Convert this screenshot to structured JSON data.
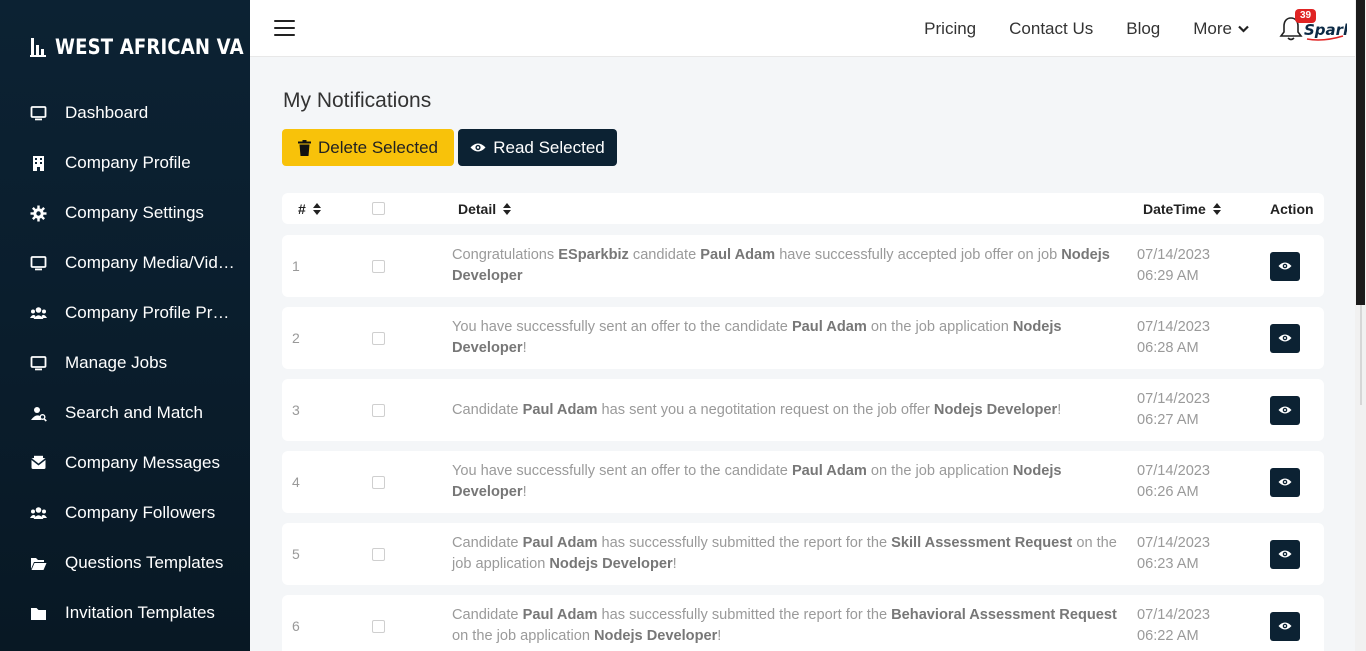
{
  "brand": {
    "name": "WEST AFRICAN VA"
  },
  "sidebar": {
    "items": [
      {
        "label": "Dashboard",
        "icon": "monitor-icon"
      },
      {
        "label": "Company Profile",
        "icon": "building-icon"
      },
      {
        "label": "Company Settings",
        "icon": "gear-icon"
      },
      {
        "label": "Company Media/Videos",
        "icon": "monitor-icon"
      },
      {
        "label": "Company Profile Preview",
        "icon": "users-icon"
      },
      {
        "label": "Manage Jobs",
        "icon": "monitor-icon"
      },
      {
        "label": "Search and Match",
        "icon": "user-search-icon"
      },
      {
        "label": "Company Messages",
        "icon": "envelope-icon"
      },
      {
        "label": "Company Followers",
        "icon": "users-icon"
      },
      {
        "label": "Questions Templates",
        "icon": "folder-open-icon"
      },
      {
        "label": "Invitation Templates",
        "icon": "folder-icon"
      }
    ]
  },
  "topbar": {
    "links": [
      "Pricing",
      "Contact Us",
      "Blog"
    ],
    "more_label": "More",
    "notification_count": "39",
    "logo_text": "Spark"
  },
  "main": {
    "title": "My Notifications",
    "delete_label": "Delete Selected",
    "read_label": "Read Selected",
    "columns": {
      "num": "#",
      "detail": "Detail",
      "datetime": "DateTime",
      "action": "Action"
    }
  },
  "notifications": [
    {
      "num": "1",
      "date": "07/14/2023",
      "time": "06:29 AM",
      "parts": [
        [
          "Congratulations ",
          false
        ],
        [
          "ESparkbiz",
          true
        ],
        [
          " candidate ",
          false
        ],
        [
          "Paul Adam",
          true
        ],
        [
          " have successfully accepted job offer on job ",
          false
        ],
        [
          "Nodejs Developer",
          true
        ]
      ]
    },
    {
      "num": "2",
      "date": "07/14/2023",
      "time": "06:28 AM",
      "parts": [
        [
          "You have successfully sent an offer to the candidate ",
          false
        ],
        [
          "Paul Adam",
          true
        ],
        [
          " on the job application ",
          false
        ],
        [
          "Nodejs Developer",
          true
        ],
        [
          "!",
          false
        ]
      ]
    },
    {
      "num": "3",
      "date": "07/14/2023",
      "time": "06:27 AM",
      "parts": [
        [
          "Candidate ",
          false
        ],
        [
          "Paul Adam",
          true
        ],
        [
          " has sent you a negotitation request on the job offer ",
          false
        ],
        [
          "Nodejs Developer",
          true
        ],
        [
          "!",
          false
        ]
      ]
    },
    {
      "num": "4",
      "date": "07/14/2023",
      "time": "06:26 AM",
      "parts": [
        [
          "You have successfully sent an offer to the candidate ",
          false
        ],
        [
          "Paul Adam",
          true
        ],
        [
          " on the job application ",
          false
        ],
        [
          "Nodejs Developer",
          true
        ],
        [
          "!",
          false
        ]
      ]
    },
    {
      "num": "5",
      "date": "07/14/2023",
      "time": "06:23 AM",
      "parts": [
        [
          "Candidate ",
          false
        ],
        [
          "Paul Adam",
          true
        ],
        [
          " has successfully submitted the report for the ",
          false
        ],
        [
          "Skill Assessment Request",
          true
        ],
        [
          " on the job application ",
          false
        ],
        [
          "Nodejs Developer",
          true
        ],
        [
          "!",
          false
        ]
      ]
    },
    {
      "num": "6",
      "date": "07/14/2023",
      "time": "06:22 AM",
      "parts": [
        [
          "Candidate ",
          false
        ],
        [
          "Paul Adam",
          true
        ],
        [
          " has successfully submitted the report for the ",
          false
        ],
        [
          "Behavioral Assessment Request",
          true
        ],
        [
          " on the job application ",
          false
        ],
        [
          "Nodejs Developer",
          true
        ],
        [
          "!",
          false
        ]
      ]
    }
  ],
  "colors": {
    "sidebar": "#0c2233",
    "accent_yellow": "#f8c20a",
    "badge_red": "#e02424"
  }
}
